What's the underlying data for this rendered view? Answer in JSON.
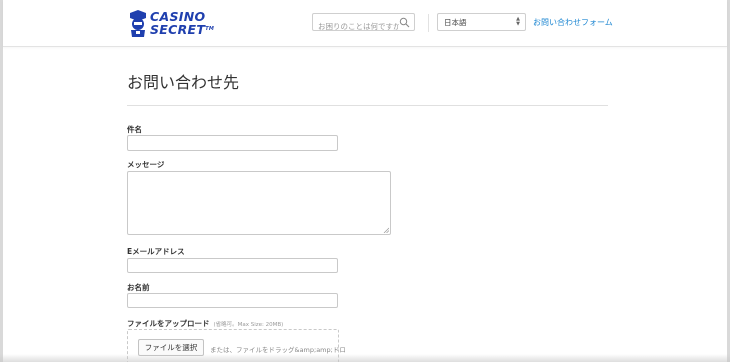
{
  "header": {
    "logo": {
      "line1": "CASINO",
      "line2": "SECRET",
      "tm": "TM"
    },
    "search": {
      "placeholder": "お困りのことは何ですか?"
    },
    "language": {
      "selected": "日本語"
    },
    "contact_link": "お問い合わせフォーム"
  },
  "page": {
    "title": "お問い合わせ先"
  },
  "form": {
    "subject_label": "件名",
    "message_label": "メッセージ",
    "email_label": "Eメールアドレス",
    "name_label": "お名前",
    "upload_label": "ファイルをアップロード",
    "upload_hint": "(省略可。Max Size: 20MB)",
    "choose_file_button": "ファイルを選択",
    "drop_text": "または、ファイルをドラッグ&amp;amp;ドロ"
  },
  "colors": {
    "brand": "#1f3fae",
    "link": "#1e87d2"
  }
}
